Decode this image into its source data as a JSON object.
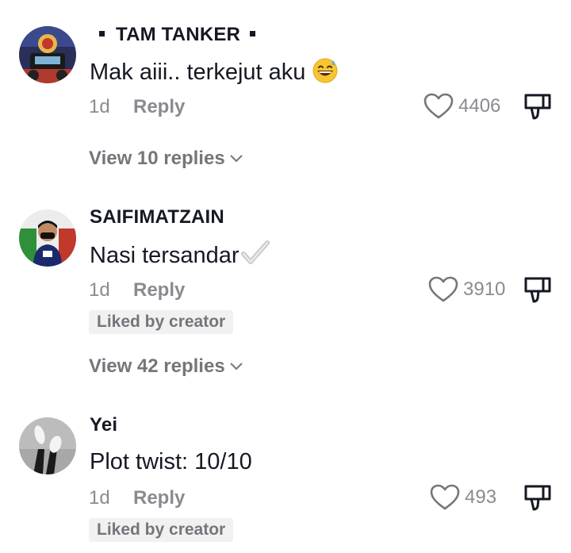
{
  "comments": [
    {
      "username": "TAM TANKER",
      "text": "Mak aiii.. terkejut aku",
      "emoji": "grinning-sweat-emoji",
      "time": "1d",
      "reply_label": "Reply",
      "likes": "4406",
      "view_replies": "View 10 replies"
    },
    {
      "username": "SAIFIMATZAIN",
      "text": "Nasi tersandar",
      "emoji": "check-mark-emoji",
      "time": "1d",
      "reply_label": "Reply",
      "likes": "3910",
      "liked_by_creator": "Liked by creator",
      "view_replies": "View 42 replies"
    },
    {
      "username": "Yei",
      "text": "Plot twist: 10/10",
      "time": "1d",
      "reply_label": "Reply",
      "likes": "493",
      "liked_by_creator": "Liked by creator"
    }
  ],
  "colors": {
    "primary_text": "#161823",
    "secondary_text": "#8a8b91",
    "badge_bg": "#f1f1f2"
  }
}
